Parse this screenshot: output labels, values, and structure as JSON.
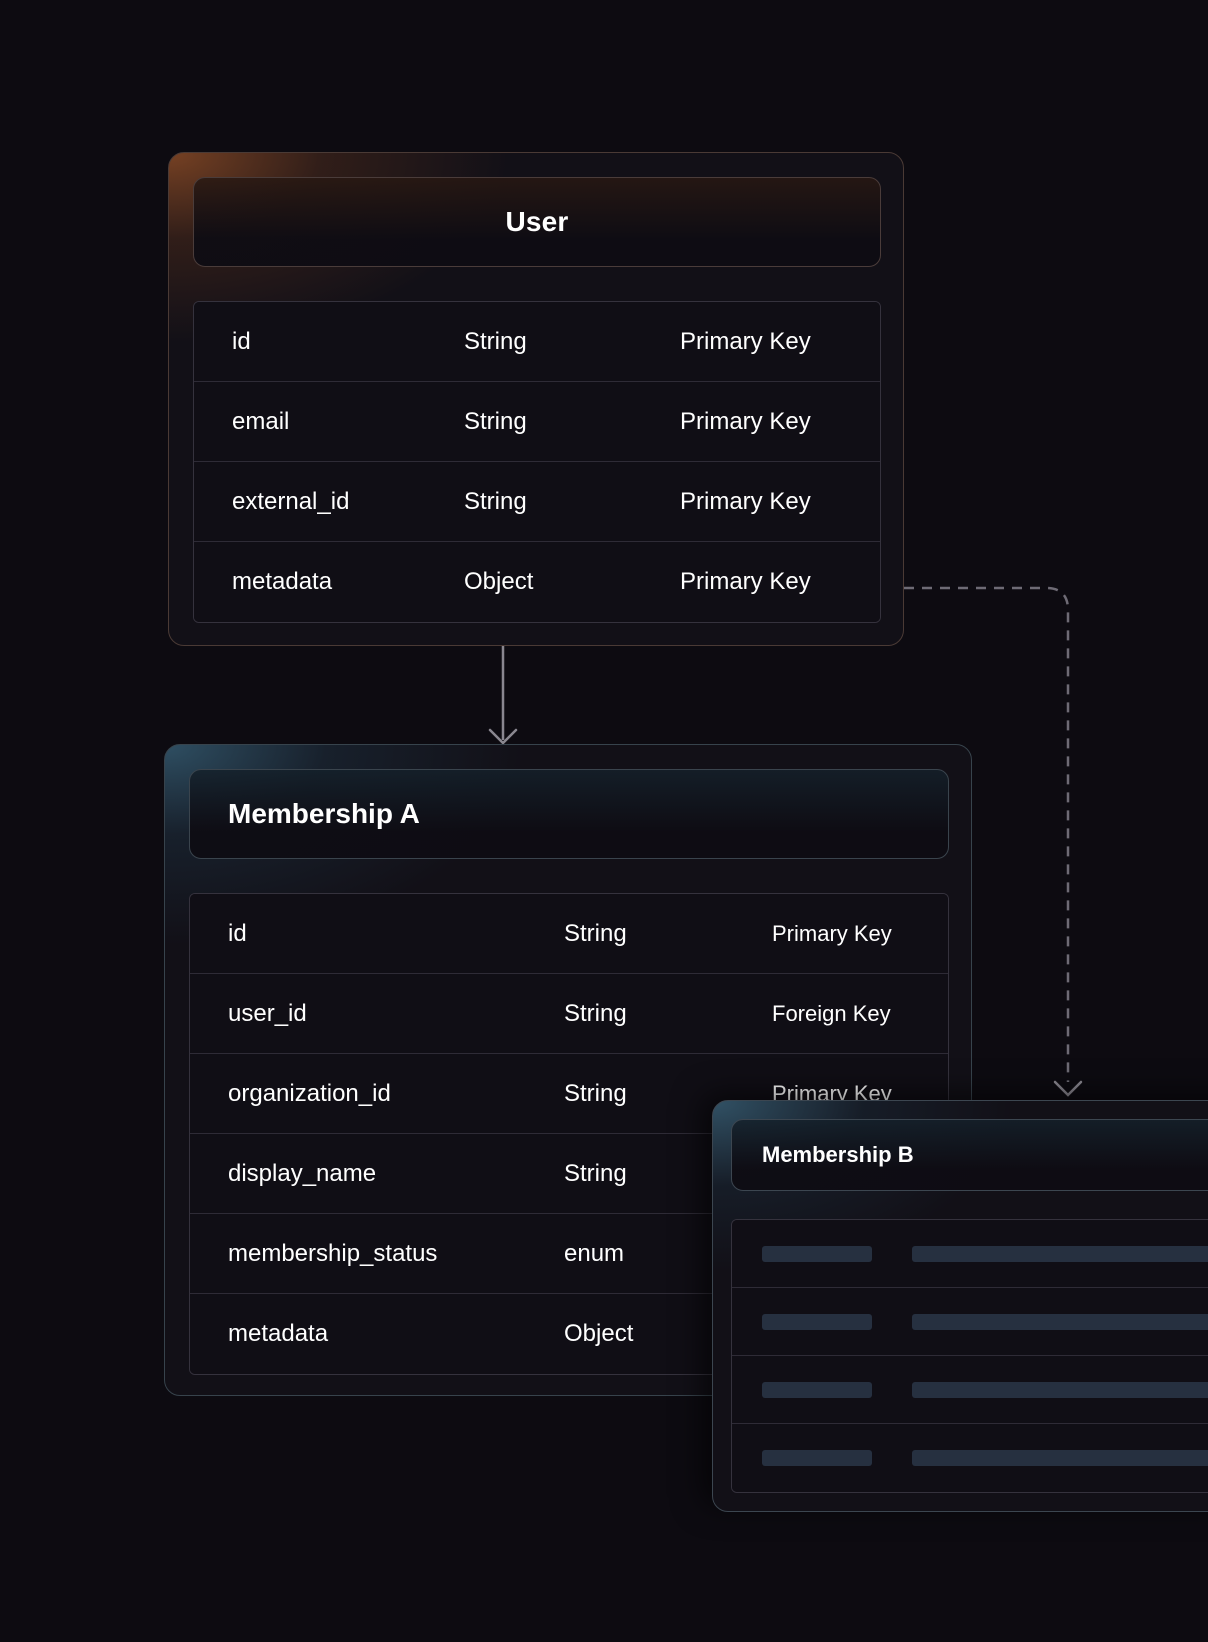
{
  "user": {
    "title": "User",
    "rows": [
      {
        "name": "id",
        "type": "String",
        "key": "Primary Key"
      },
      {
        "name": "email",
        "type": "String",
        "key": "Primary Key"
      },
      {
        "name": "external_id",
        "type": "String",
        "key": "Primary Key"
      },
      {
        "name": "metadata",
        "type": "Object",
        "key": "Primary Key"
      }
    ]
  },
  "membership_a": {
    "title": "Membership A",
    "rows": [
      {
        "name": "id",
        "type": "String",
        "key": "Primary Key"
      },
      {
        "name": "user_id",
        "type": "String",
        "key": "Foreign Key"
      },
      {
        "name": "organization_id",
        "type": "String",
        "key": "Primary Key"
      },
      {
        "name": "display_name",
        "type": "String",
        "key": ""
      },
      {
        "name": "membership_status",
        "type": "enum",
        "key": ""
      },
      {
        "name": "metadata",
        "type": "Object",
        "key": ""
      }
    ]
  },
  "membership_b": {
    "title": "Membership B"
  },
  "colors": {
    "background": "#0d0b11",
    "user_accent": "#c8692d",
    "membership_accent": "#4682a0",
    "connector": "#8a8790",
    "placeholder": "#263040"
  }
}
